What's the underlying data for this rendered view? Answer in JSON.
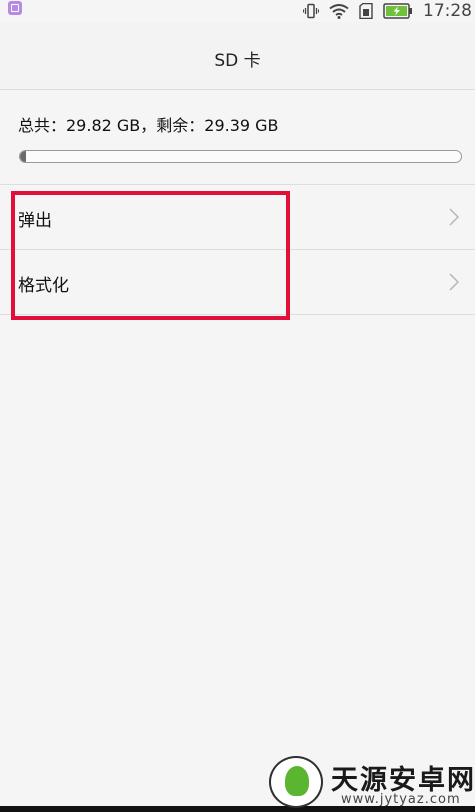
{
  "status_bar": {
    "time": "17:28",
    "icons": [
      "app-notification-icon",
      "vibrate-icon",
      "wifi-icon",
      "sim-card-icon",
      "battery-charging-icon"
    ],
    "battery_color": "#6fc13a"
  },
  "header": {
    "title": "SD 卡"
  },
  "storage": {
    "summary": "总共：29.82 GB，剩余：29.39 GB",
    "used_fraction": 0.014
  },
  "menu": {
    "items": [
      {
        "label": "弹出",
        "icon": "chevron-right-icon"
      },
      {
        "label": "格式化",
        "icon": "chevron-right-icon"
      }
    ]
  },
  "annotation": {
    "highlight_color": "#e0103a"
  },
  "watermark": {
    "title": "天源安卓网",
    "url": "www.jytyaz.com"
  }
}
